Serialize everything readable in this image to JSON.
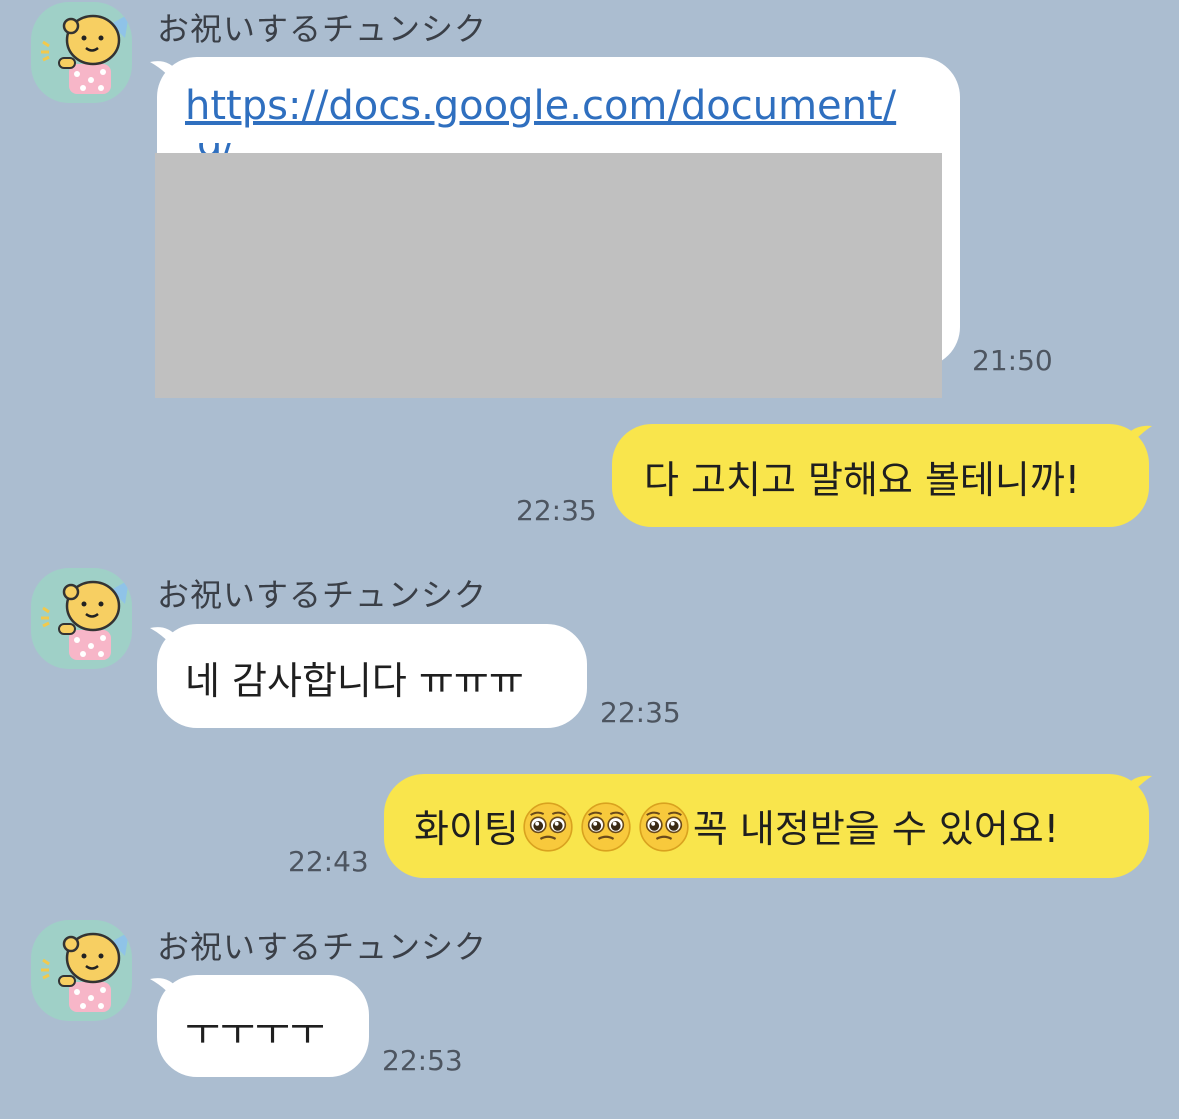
{
  "sender_name": "お祝いするチュンシク",
  "messages": [
    {
      "from": "other",
      "link": "https://docs.google.com/document/",
      "link_cut": "d/",
      "time": "21:50"
    },
    {
      "from": "me",
      "text": "다 고치고 말해요 볼테니까!",
      "time": "22:35"
    },
    {
      "from": "other",
      "text": "네 감사합니다 ㅠㅠㅠ",
      "time": "22:35"
    },
    {
      "from": "me",
      "text_before": "화이팅",
      "emoji": "pleading-face",
      "emoji_count": 3,
      "text_after": "꼭 내정받을 수 있어요!",
      "time": "22:43"
    },
    {
      "from": "other",
      "text": "ㅜㅜㅜㅜ",
      "time": "22:53"
    }
  ],
  "colors": {
    "background": "#abbdd0",
    "incoming_bubble": "#ffffff",
    "outgoing_bubble": "#f9e54c",
    "link": "#2f6fbf",
    "avatar_bg": "#9fd0c7"
  }
}
